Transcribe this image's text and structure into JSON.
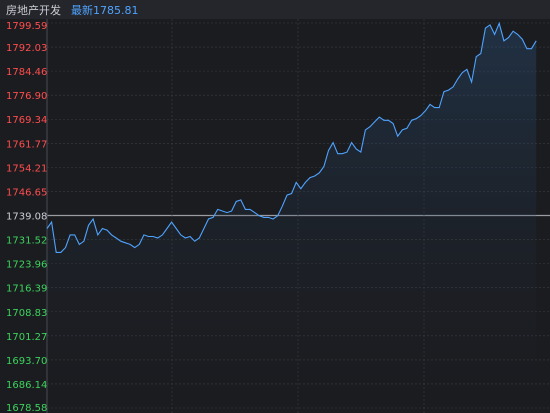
{
  "header": {
    "title": "房地产开发",
    "latest_label": "最新",
    "latest_value": "1785.81"
  },
  "colors": {
    "up": "#ff4d4d",
    "down": "#3cd35c",
    "neutral": "#c9cdd4",
    "line": "#4ea3ff",
    "grid": "#3a3c43",
    "background": "#1b1c20"
  },
  "chart_data": {
    "type": "line",
    "title": "",
    "xlabel": "",
    "ylabel": "",
    "ylim": [
      1678.58,
      1799.59
    ],
    "baseline": 1739.08,
    "y_ticks": [
      "1799.59",
      "1792.03",
      "1784.46",
      "1776.90",
      "1769.34",
      "1761.77",
      "1754.21",
      "1746.65",
      "1739.08",
      "1731.52",
      "1723.96",
      "1716.39",
      "1708.83",
      "1701.27",
      "1693.70",
      "1686.14",
      "1678.58"
    ],
    "series": [
      {
        "values": [
          1735.0,
          1737.0,
          1727.5,
          1727.5,
          1729.0,
          1733.0,
          1733.0,
          1730.0,
          1731.0,
          1736.0,
          1738.0,
          1733.0,
          1735.0,
          1734.5,
          1733.0,
          1732.0,
          1731.0,
          1730.5,
          1730.0,
          1729.0,
          1730.0,
          1733.0,
          1732.5,
          1732.5,
          1732.0,
          1733.0,
          1735.0,
          1737.0,
          1735.0,
          1733.0,
          1732.0,
          1732.5,
          1731.0,
          1732.0,
          1735.0,
          1738.0,
          1738.5,
          1741.0,
          1740.5,
          1740.0,
          1740.5,
          1743.5,
          1744.0,
          1741.0,
          1741.0,
          1740.0,
          1739.0,
          1738.5,
          1738.5,
          1738.0,
          1739.0,
          1742.0,
          1745.5,
          1746.0,
          1749.5,
          1747.5,
          1749.5,
          1751.0,
          1751.5,
          1752.5,
          1754.5,
          1759.5,
          1762.0,
          1758.5,
          1758.5,
          1759.0,
          1762.0,
          1760.0,
          1759.0,
          1766.0,
          1767.0,
          1768.5,
          1770.0,
          1769.0,
          1769.0,
          1768.0,
          1764.0,
          1766.0,
          1766.5,
          1769.0,
          1769.5,
          1770.5,
          1772.0,
          1774.0,
          1773.0,
          1773.0,
          1778.0,
          1778.5,
          1779.5,
          1782.0,
          1784.0,
          1785.0,
          1781.0,
          1789.0,
          1790.0,
          1798.0,
          1799.0,
          1796.0,
          1799.5,
          1794.0,
          1795.0,
          1797.0,
          1796.0,
          1794.5,
          1791.5,
          1791.5,
          1794.0
        ]
      }
    ],
    "x_divisions": 4,
    "x_slots": 110
  }
}
